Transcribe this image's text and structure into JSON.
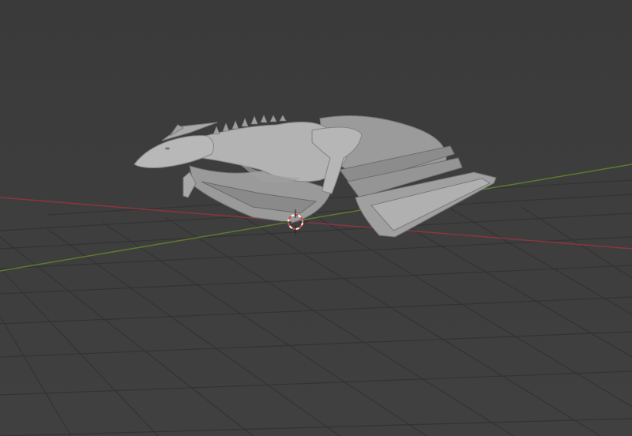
{
  "viewport": {
    "view": "3D Viewport",
    "shading": "solid"
  },
  "scene": {
    "object": "dragon-mesh",
    "cursor": "3d-cursor-icon",
    "axes": [
      "x-axis",
      "y-axis"
    ]
  },
  "colors": {
    "background": "#3d3d3d",
    "grid_line": "#2f2f2f",
    "x_axis": "#8a3540",
    "y_axis": "#5d7a2e",
    "mesh": "#a8a8a8",
    "mesh_shadow": "#6f6f6f",
    "mesh_highlight": "#c4c4c4",
    "cursor_red": "#d24a4a",
    "cursor_white": "#ffffff"
  }
}
